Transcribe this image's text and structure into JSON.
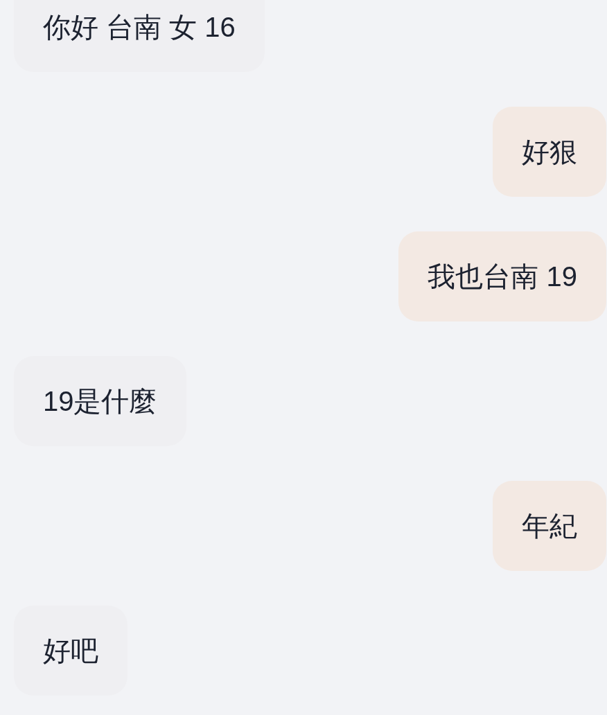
{
  "messages": [
    {
      "kind": "received",
      "text": "你好 台南 女 16"
    },
    {
      "kind": "sent",
      "text": "好狠"
    },
    {
      "kind": "sent",
      "text": "我也台南 19"
    },
    {
      "kind": "received",
      "text": "19是什麼"
    },
    {
      "kind": "sent",
      "text": "年紀"
    },
    {
      "kind": "received",
      "text": "好吧"
    }
  ]
}
